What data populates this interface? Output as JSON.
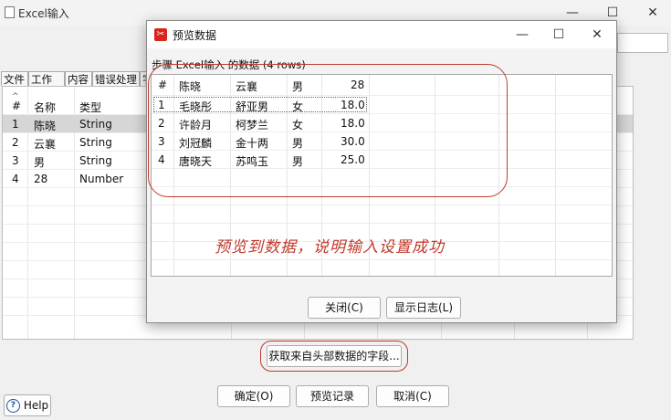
{
  "bg_window": {
    "title": "Excel输入",
    "minimize": "—",
    "maximize": "☐",
    "close": "✕",
    "tabs": [
      "文件",
      "工作表",
      "内容",
      "错误处理",
      "字"
    ],
    "grid": {
      "columns": [
        "#",
        "名称",
        "类型"
      ],
      "rows": [
        [
          "1",
          "陈晓",
          "String"
        ],
        [
          "2",
          "云襄",
          "String"
        ],
        [
          "3",
          "男",
          "String"
        ],
        [
          "4",
          "28",
          "Number"
        ]
      ]
    },
    "get_fields_button": "获取来自头部数据的字段...",
    "ok_button": "确定(O)",
    "preview_button": "预览记录",
    "cancel_button": "取消(C)",
    "help_button": "Help"
  },
  "dialog": {
    "title": "预览数据",
    "caption": "步骤 Excel输入 的数据 (4 rows)",
    "columns": [
      "#",
      "陈晓",
      "云襄",
      "男",
      "28"
    ],
    "rows": [
      [
        "1",
        "毛晓彤",
        "舒亚男",
        "女",
        "18.0"
      ],
      [
        "2",
        "许龄月",
        "柯梦兰",
        "女",
        "18.0"
      ],
      [
        "3",
        "刘冠麟",
        "金十两",
        "男",
        "30.0"
      ],
      [
        "4",
        "唐晓天",
        "苏鸣玉",
        "男",
        "25.0"
      ]
    ],
    "close_button": "关闭(C)",
    "log_button": "显示日志(L)"
  },
  "annotation": "预览到数据，说明输入设置成功",
  "colors": {
    "annotation": "#c0392b",
    "dialog_icon": "#d9261c"
  }
}
